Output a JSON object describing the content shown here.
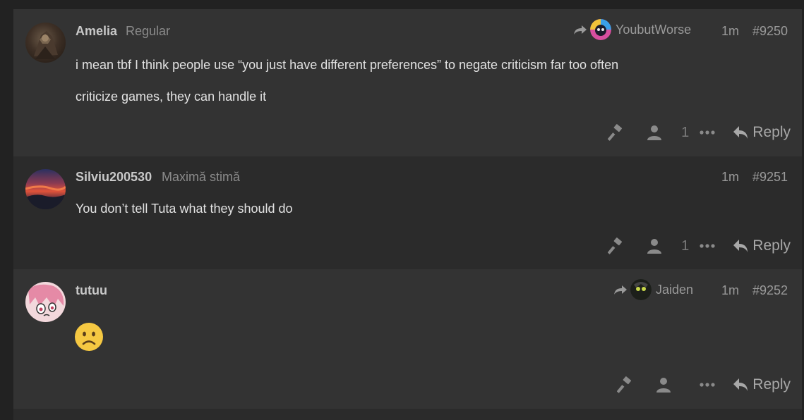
{
  "posts": [
    {
      "username": "Amelia",
      "user_title": "Regular",
      "reply_to": "YoubutWorse",
      "time": "1m",
      "post_number": "#9250",
      "paragraphs": [
        "i mean tbf I think people use “you just have different preferences” to negate criticism far too often",
        "criticize games, they can handle it"
      ],
      "like_count": "1",
      "reply_label": "Reply"
    },
    {
      "username": "Silviu200530",
      "user_title": "Maximă stimă",
      "time": "1m",
      "post_number": "#9251",
      "paragraphs": [
        "You don’t tell Tuta what they should do"
      ],
      "like_count": "1",
      "reply_label": "Reply"
    },
    {
      "username": "tutuu",
      "reply_to": "Jaiden",
      "time": "1m",
      "post_number": "#9252",
      "emoji": "slightly-frowning-face",
      "reply_label": "Reply"
    }
  ],
  "icons": {
    "moderate": "gavel-icon",
    "user": "user-icon",
    "more": "ellipsis-icon",
    "reply": "reply-arrow-icon"
  },
  "colors": {
    "panel_a": "#333333",
    "panel_b": "#2b2b2b",
    "background": "#222222"
  }
}
